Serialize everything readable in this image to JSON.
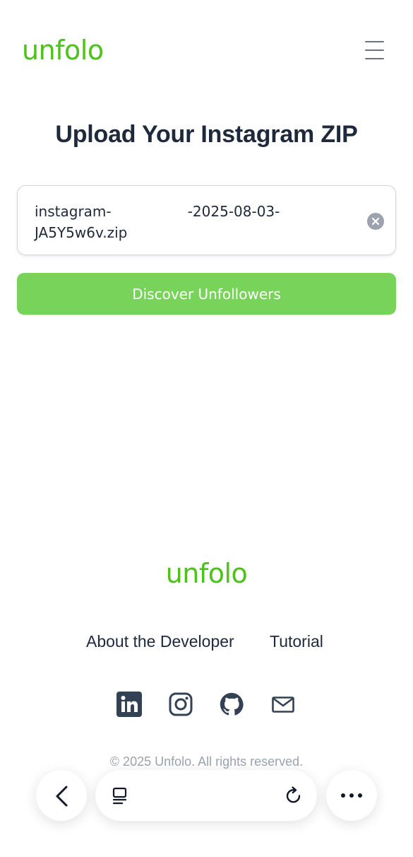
{
  "header": {
    "logo": "unfolo",
    "menu_icon": "hamburger-menu-icon"
  },
  "main": {
    "title": "Upload Your Instagram ZIP",
    "file": {
      "name_line1": "instagram-                 -2025-08-03-",
      "name_line2": "JA5Y5w6v.zip",
      "clear_icon": "clear-circle-icon"
    },
    "discover_button": "Discover Unfollowers"
  },
  "footer": {
    "logo": "unfolo",
    "links": {
      "about": "About the Developer",
      "tutorial": "Tutorial"
    },
    "social_icons": [
      "linkedin-icon",
      "instagram-icon",
      "github-icon",
      "mail-icon"
    ],
    "copyright": "© 2025 Unfolo. All rights reserved."
  },
  "browser": {
    "icons": [
      "back-icon",
      "tabs-icon",
      "reload-icon",
      "more-icon"
    ]
  },
  "colors": {
    "brand": "#4cc21a",
    "button": "#78d35a",
    "title": "#1e293b",
    "muted": "#9ca3af"
  }
}
